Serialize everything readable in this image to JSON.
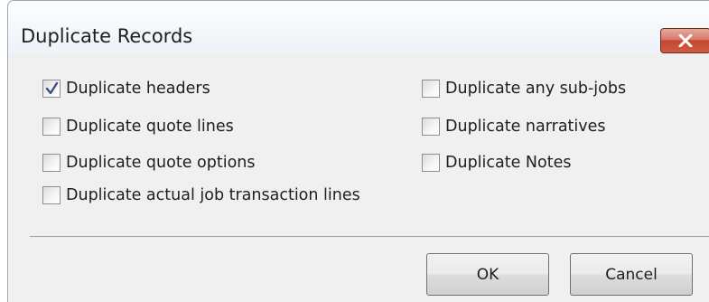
{
  "dialog": {
    "title": "Duplicate Records",
    "close_icon": "close-icon",
    "accent_color": "#c44631"
  },
  "options": {
    "left": [
      {
        "label": "Duplicate headers",
        "checked": true
      },
      {
        "label": "Duplicate quote lines",
        "checked": false
      },
      {
        "label": "Duplicate quote options",
        "checked": false
      },
      {
        "label": "Duplicate actual job transaction lines",
        "checked": false
      }
    ],
    "right": [
      {
        "label": "Duplicate any sub-jobs",
        "checked": false
      },
      {
        "label": "Duplicate narratives",
        "checked": false
      },
      {
        "label": "Duplicate Notes",
        "checked": false
      }
    ]
  },
  "buttons": {
    "ok_label": "OK",
    "cancel_label": "Cancel"
  }
}
